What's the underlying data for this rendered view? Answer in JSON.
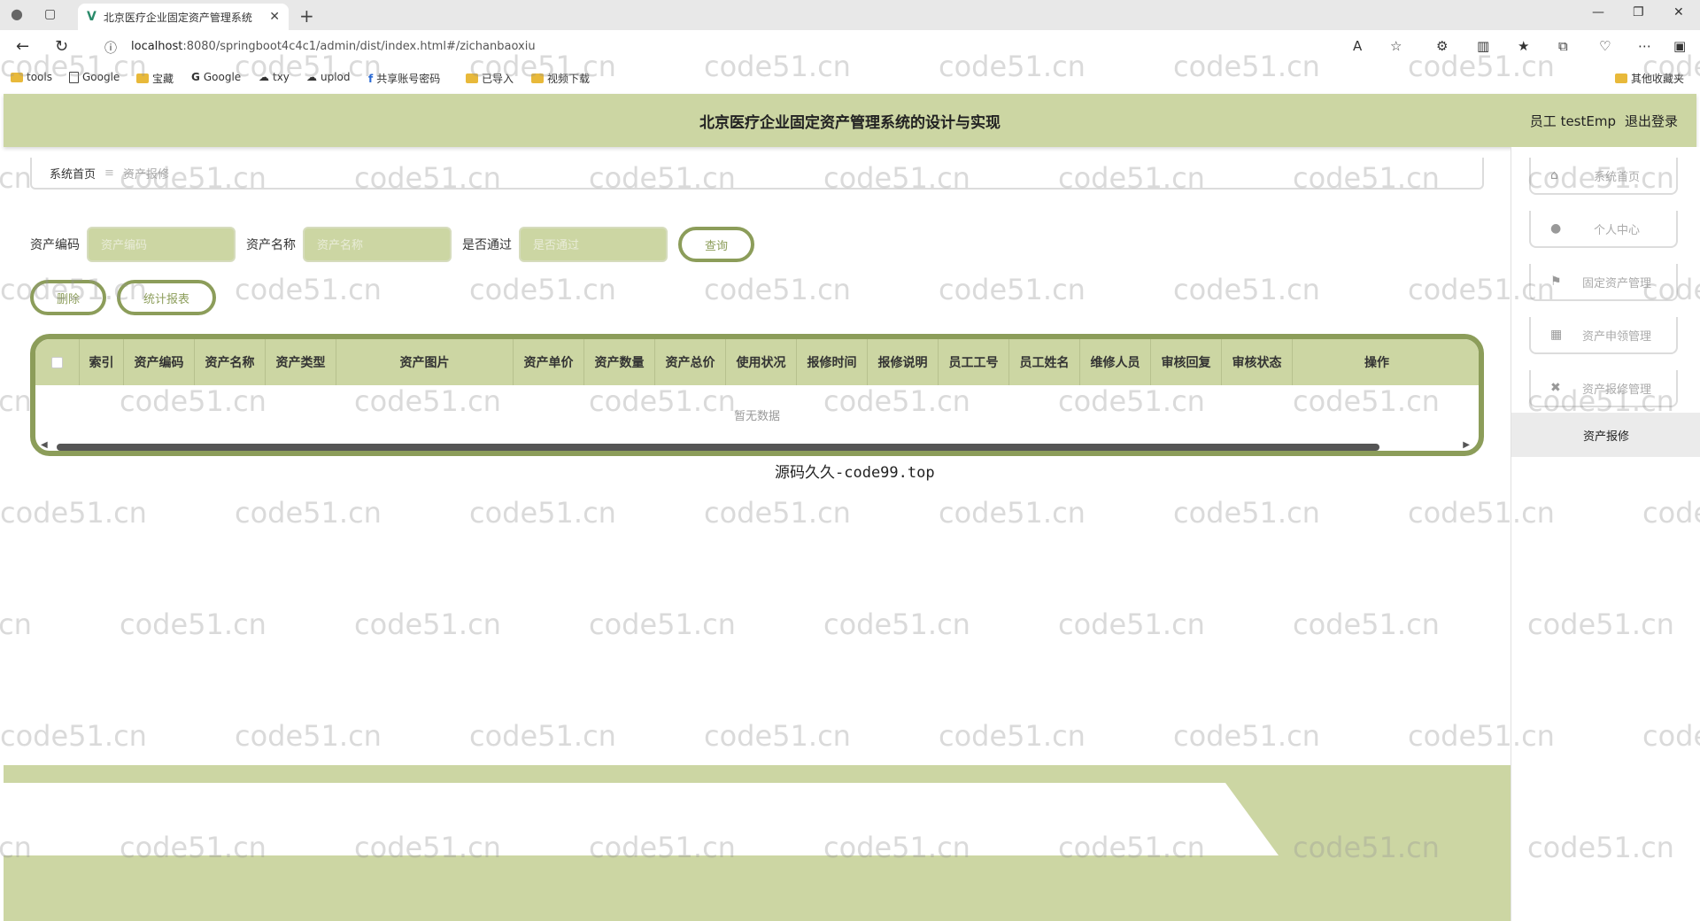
{
  "browser": {
    "tab_title": "北京医疗企业固定资产管理系统",
    "url_host": "localhost",
    "url_rest": ":8080/springboot4c4c1/admin/dist/index.html#/zichanbaoxiu",
    "bookmarks": [
      "tools",
      "Google",
      "宝藏",
      "Google",
      "txy",
      "uplod",
      "共享账号密码",
      "已导入",
      "视频下载"
    ],
    "other_bookmarks": "其他收藏夹"
  },
  "header": {
    "title": "北京医疗企业固定资产管理系统的设计与实现",
    "user": "员工 testEmp",
    "logout": "退出登录"
  },
  "breadcrumb": {
    "home": "系统首页",
    "current": "资产报修"
  },
  "search": {
    "asset_code_label": "资产编码",
    "asset_code_placeholder": "资产编码",
    "asset_name_label": "资产名称",
    "asset_name_placeholder": "资产名称",
    "approved_label": "是否通过",
    "approved_placeholder": "是否通过",
    "query_button": "查询"
  },
  "actions": {
    "delete": "删除",
    "report": "统计报表"
  },
  "table": {
    "columns": [
      "索引",
      "资产编码",
      "资产名称",
      "资产类型",
      "资产图片",
      "资产单价",
      "资产数量",
      "资产总价",
      "使用状况",
      "报修时间",
      "报修说明",
      "员工工号",
      "员工姓名",
      "维修人员",
      "审核回复",
      "审核状态",
      "操作"
    ],
    "empty_text": "暂无数据"
  },
  "note": "源码久久-code99.top",
  "sidebar": {
    "items": [
      {
        "label": "系统首页",
        "icon": "home-icon"
      },
      {
        "label": "个人中心",
        "icon": "user-icon"
      },
      {
        "label": "固定资产管理",
        "icon": "flag-icon"
      },
      {
        "label": "资产申领管理",
        "icon": "grid-icon"
      },
      {
        "label": "资产报修管理",
        "icon": "tool-icon"
      }
    ],
    "sub_active": "资产报修"
  },
  "watermark": "code51.cn",
  "colors": {
    "accent": "#ccd6a3",
    "accent_dark": "#8c9d5a"
  }
}
